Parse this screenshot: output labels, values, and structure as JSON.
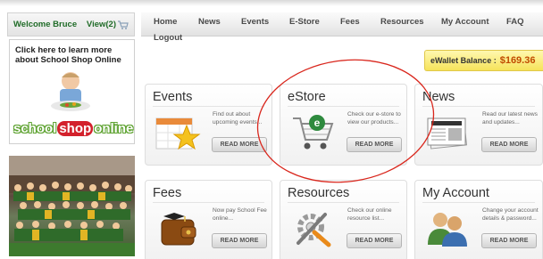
{
  "welcome": {
    "text": "Welcome Bruce",
    "view_label": "View(2)"
  },
  "banner": {
    "text": "Click here to learn more about School Shop Online",
    "logo": [
      "school",
      "shop",
      "online"
    ]
  },
  "nav": {
    "items": [
      "Home",
      "News",
      "Events",
      "E-Store",
      "Fees",
      "Resources",
      "My Account",
      "FAQ"
    ],
    "logout": "Logout"
  },
  "wallet": {
    "label": "eWallet Balance :",
    "value": "$169.36"
  },
  "cards": [
    {
      "title": "Events",
      "desc": "Find out about upcoming events...",
      "button": "READ MORE",
      "icon": "calendar-star-icon"
    },
    {
      "title": "eStore",
      "desc": "Check our e-store to view our products...",
      "button": "READ MORE",
      "icon": "shopping-cart-icon"
    },
    {
      "title": "News",
      "desc": "Read our latest news and updates...",
      "button": "READ MORE",
      "icon": "newspaper-icon"
    },
    {
      "title": "Fees",
      "desc": "Now pay School Fee online...",
      "button": "READ MORE",
      "icon": "wallet-icon"
    },
    {
      "title": "Resources",
      "desc": "Check our online resource list...",
      "button": "READ MORE",
      "icon": "tools-icon"
    },
    {
      "title": "My Account",
      "desc": "Change your account details & password...",
      "button": "READ MORE",
      "icon": "users-icon"
    }
  ],
  "colors": {
    "welcome": "#1f6b27",
    "highlight": "#d9261c",
    "wallet_value": "#c04a00"
  }
}
